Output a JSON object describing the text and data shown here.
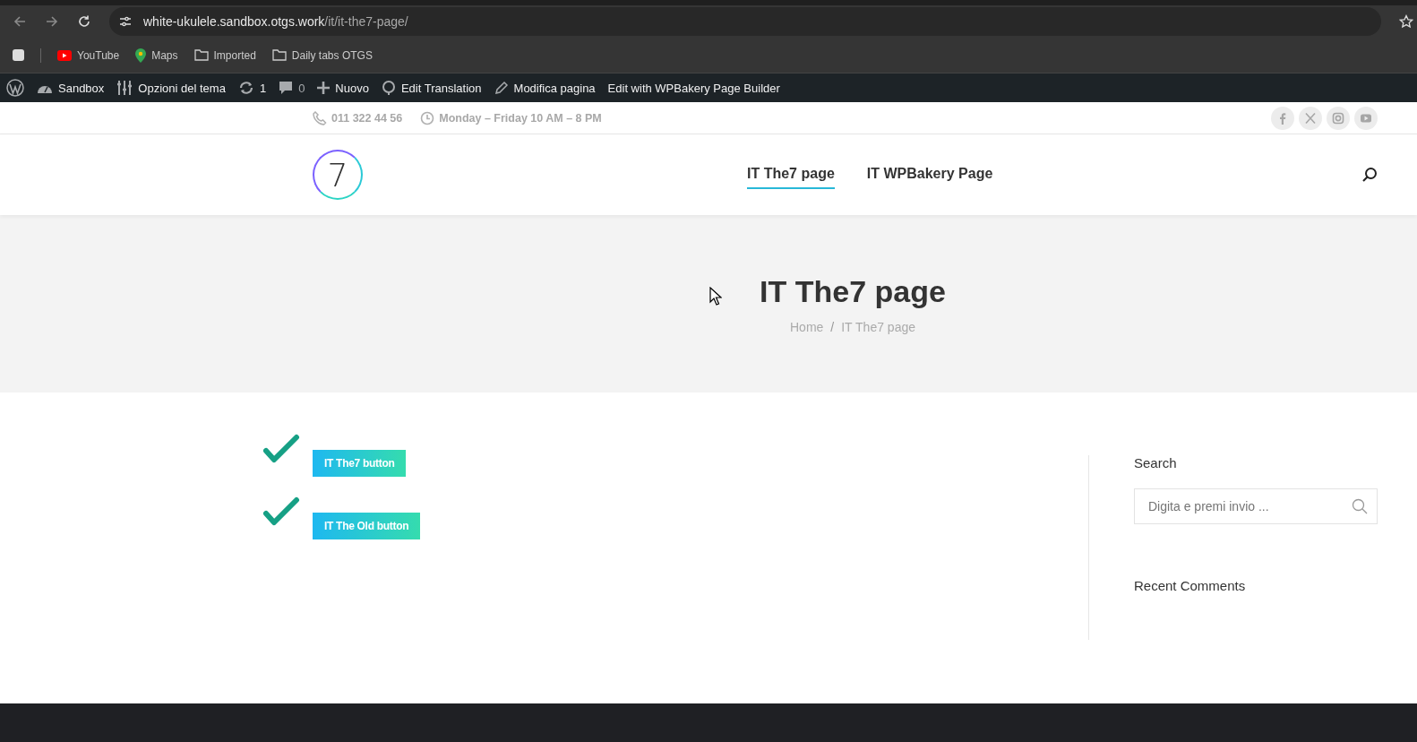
{
  "browser": {
    "url_host": "white-ukulele.sandbox.otgs.work",
    "url_path": "/it/it-the7-page/",
    "bookmarks": [
      "YouTube",
      "Maps",
      "Imported",
      "Daily tabs OTGS"
    ]
  },
  "admin_bar": {
    "items": [
      "Sandbox",
      "Opzioni del tema",
      "1",
      "0",
      "Nuovo",
      "Edit Translation",
      "Modifica pagina",
      "Edit with WPBakery Page Builder"
    ]
  },
  "top_bar": {
    "phone": "011 322 44 56",
    "hours": "Monday – Friday 10 AM – 8 PM"
  },
  "header": {
    "logo": "7",
    "nav": [
      {
        "label": "IT The7 page",
        "selected": true
      },
      {
        "label": "IT WPBakery Page",
        "selected": false
      }
    ]
  },
  "page_title": {
    "title": "IT The7 page",
    "breadcrumbs": [
      "Home",
      "IT The7 page"
    ],
    "separator": "/"
  },
  "content": {
    "buttons": [
      "IT The7 button",
      "IT The Old button"
    ]
  },
  "sidebar": {
    "search_title": "Search",
    "search_placeholder": "Digita e premi invio ...",
    "recent_title": "Recent Comments"
  }
}
